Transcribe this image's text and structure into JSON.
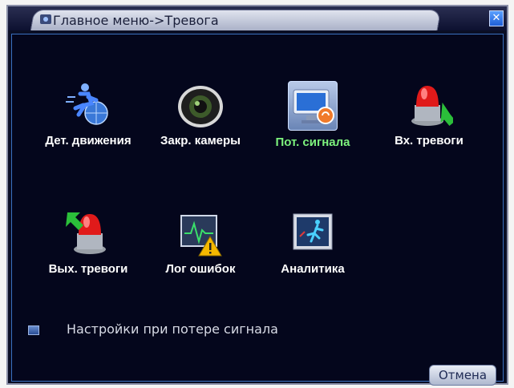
{
  "window": {
    "title": "Главное меню->Тревога",
    "close_glyph": "✕"
  },
  "menu": {
    "items": [
      {
        "label": "Дет. движения",
        "icon": "motion-detect-icon",
        "active": false
      },
      {
        "label": "Закр. камеры",
        "icon": "camera-block-icon",
        "active": false
      },
      {
        "label": "Пот. сигнала",
        "icon": "video-loss-icon",
        "active": true
      },
      {
        "label": "Вх. тревоги",
        "icon": "alarm-input-icon",
        "active": false
      },
      {
        "label": "Вых. тревоги",
        "icon": "alarm-output-icon",
        "active": false
      },
      {
        "label": "Лог ошибок",
        "icon": "error-log-icon",
        "active": false
      },
      {
        "label": "Аналитика",
        "icon": "analytics-icon",
        "active": false
      }
    ]
  },
  "settings": {
    "label": "Настройки при потере сигнала"
  },
  "buttons": {
    "cancel": "Отмена"
  },
  "colors": {
    "background": "#04061c",
    "active_label": "#7df27d",
    "label": "#ffffff"
  }
}
